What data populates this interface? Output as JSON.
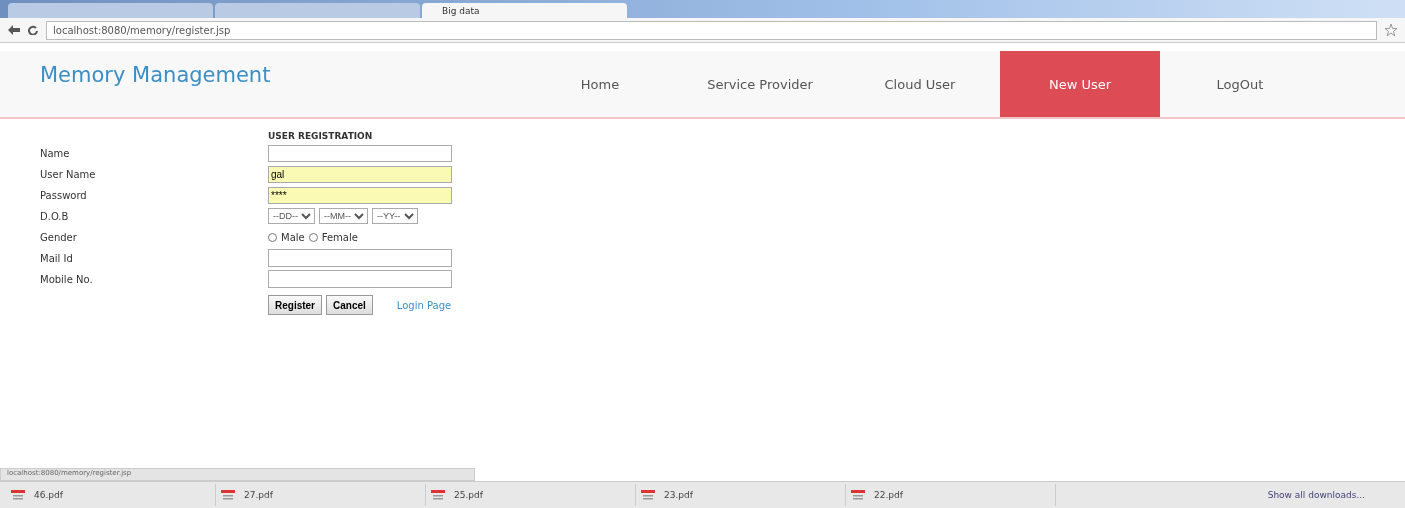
{
  "browser": {
    "tabs": [
      {
        "selected": false
      },
      {
        "selected": false
      },
      {
        "label": "Big data",
        "selected": true
      }
    ],
    "address": "localhost:8080/memory/register.jsp"
  },
  "site": {
    "title": "Memory Management",
    "nav": [
      {
        "label": "Home",
        "selected": false
      },
      {
        "label": "Service Provider",
        "selected": false
      },
      {
        "label": "Cloud User",
        "selected": false
      },
      {
        "label": "New User",
        "selected": true
      },
      {
        "label": "LogOut",
        "selected": false
      }
    ]
  },
  "form": {
    "title": "USER REGISTRATION",
    "fields": [
      {
        "kind": "text",
        "label": "Name",
        "autofill": false
      },
      {
        "kind": "text",
        "label": "User Name",
        "value": "gal",
        "autofill": true
      },
      {
        "kind": "text",
        "label": "Password",
        "value": "****",
        "autofill": true
      },
      {
        "kind": "date",
        "label": "D.O.B",
        "selects": [
          "--DD--",
          "--MM--",
          "--YY--"
        ]
      },
      {
        "kind": "radio",
        "label": "Gender",
        "options": [
          {
            "label": "Male",
            "selected": false
          },
          {
            "label": "Female",
            "selected": false
          }
        ]
      },
      {
        "kind": "area",
        "label": "Mail Id"
      },
      {
        "kind": "area",
        "label": "Mobile No."
      }
    ],
    "buttons": [
      "Register",
      "Cancel"
    ],
    "link": "Login Page"
  },
  "status_url": "localhost:8080/memory/register.jsp",
  "downloads": {
    "items": [
      "46.pdf",
      "27.pdf",
      "25.pdf",
      "23.pdf",
      "22.pdf"
    ],
    "show_all": "Show all downloads..."
  }
}
